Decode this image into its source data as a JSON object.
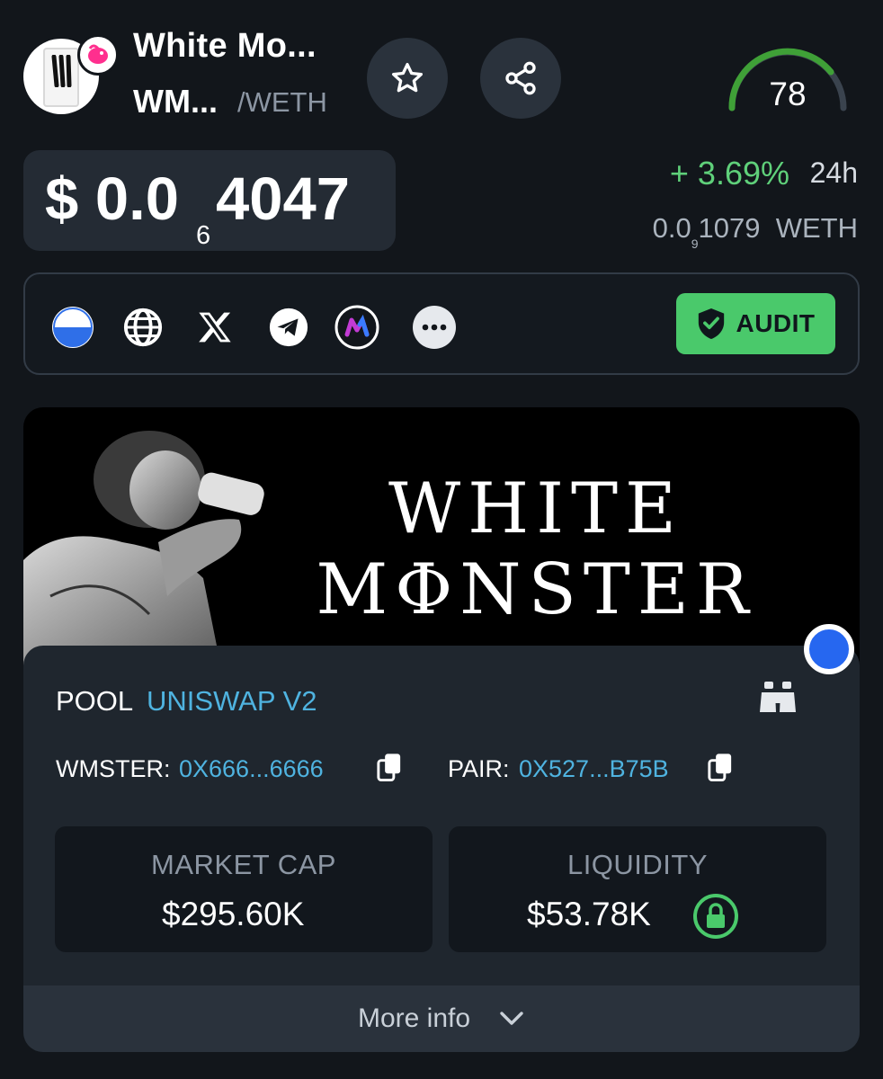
{
  "header": {
    "token_name": "White Mo...",
    "token_symbol": "WM...",
    "quote": "/WETH",
    "score": "78"
  },
  "price": {
    "prefix": "$ 0.0",
    "zeros_subscript": "6",
    "digits": "4047",
    "change": "+ 3.69%",
    "period": "24h",
    "weth_prefix": "0.0",
    "weth_subscript": "9",
    "weth_digits": "1079",
    "weth_unit": "WETH"
  },
  "links": {
    "icons": [
      "website-icon",
      "globe-icon",
      "x-icon",
      "telegram-icon",
      "app-icon",
      "more-icon"
    ],
    "audit_label": "AUDIT"
  },
  "banner": {
    "line1": "WHITE",
    "line2": "MΦNSTER"
  },
  "pool": {
    "label": "POOL",
    "name": "UNISWAP V2",
    "token_label": "WMSTER:",
    "token_address": "0X666...6666",
    "pair_label": "PAIR:",
    "pair_address": "0X527...B75B",
    "market_cap_title": "MARKET CAP",
    "market_cap_value": "$295.60K",
    "liquidity_title": "LIQUIDITY",
    "liquidity_value": "$53.78K",
    "more_info": "More info"
  },
  "colors": {
    "accent_green": "#4ac96b",
    "link_blue": "#4fb3e0",
    "background": "#12161b"
  }
}
